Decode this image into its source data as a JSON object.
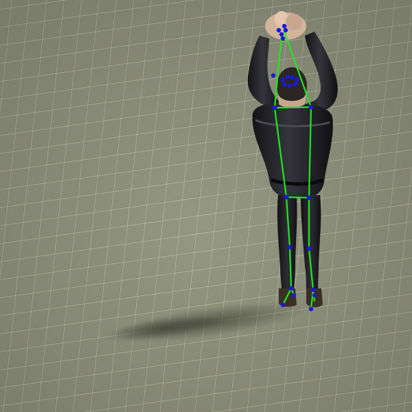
{
  "scene": {
    "description_visible_text": "",
    "colors": {
      "ground_base": "#8d9079",
      "ground_light": "#a3a68f",
      "ground_dark": "#6f7360",
      "tile_line": "#c1c3ad",
      "shadow": "#4a4c40",
      "clothing": "#1d1d21",
      "clothing_highlight": "#3a3a40",
      "skin": "#d7b8a0",
      "hair": "#2b2622",
      "skeleton_line": "#22e622",
      "keypoint": "#1a1ad6"
    }
  }
}
